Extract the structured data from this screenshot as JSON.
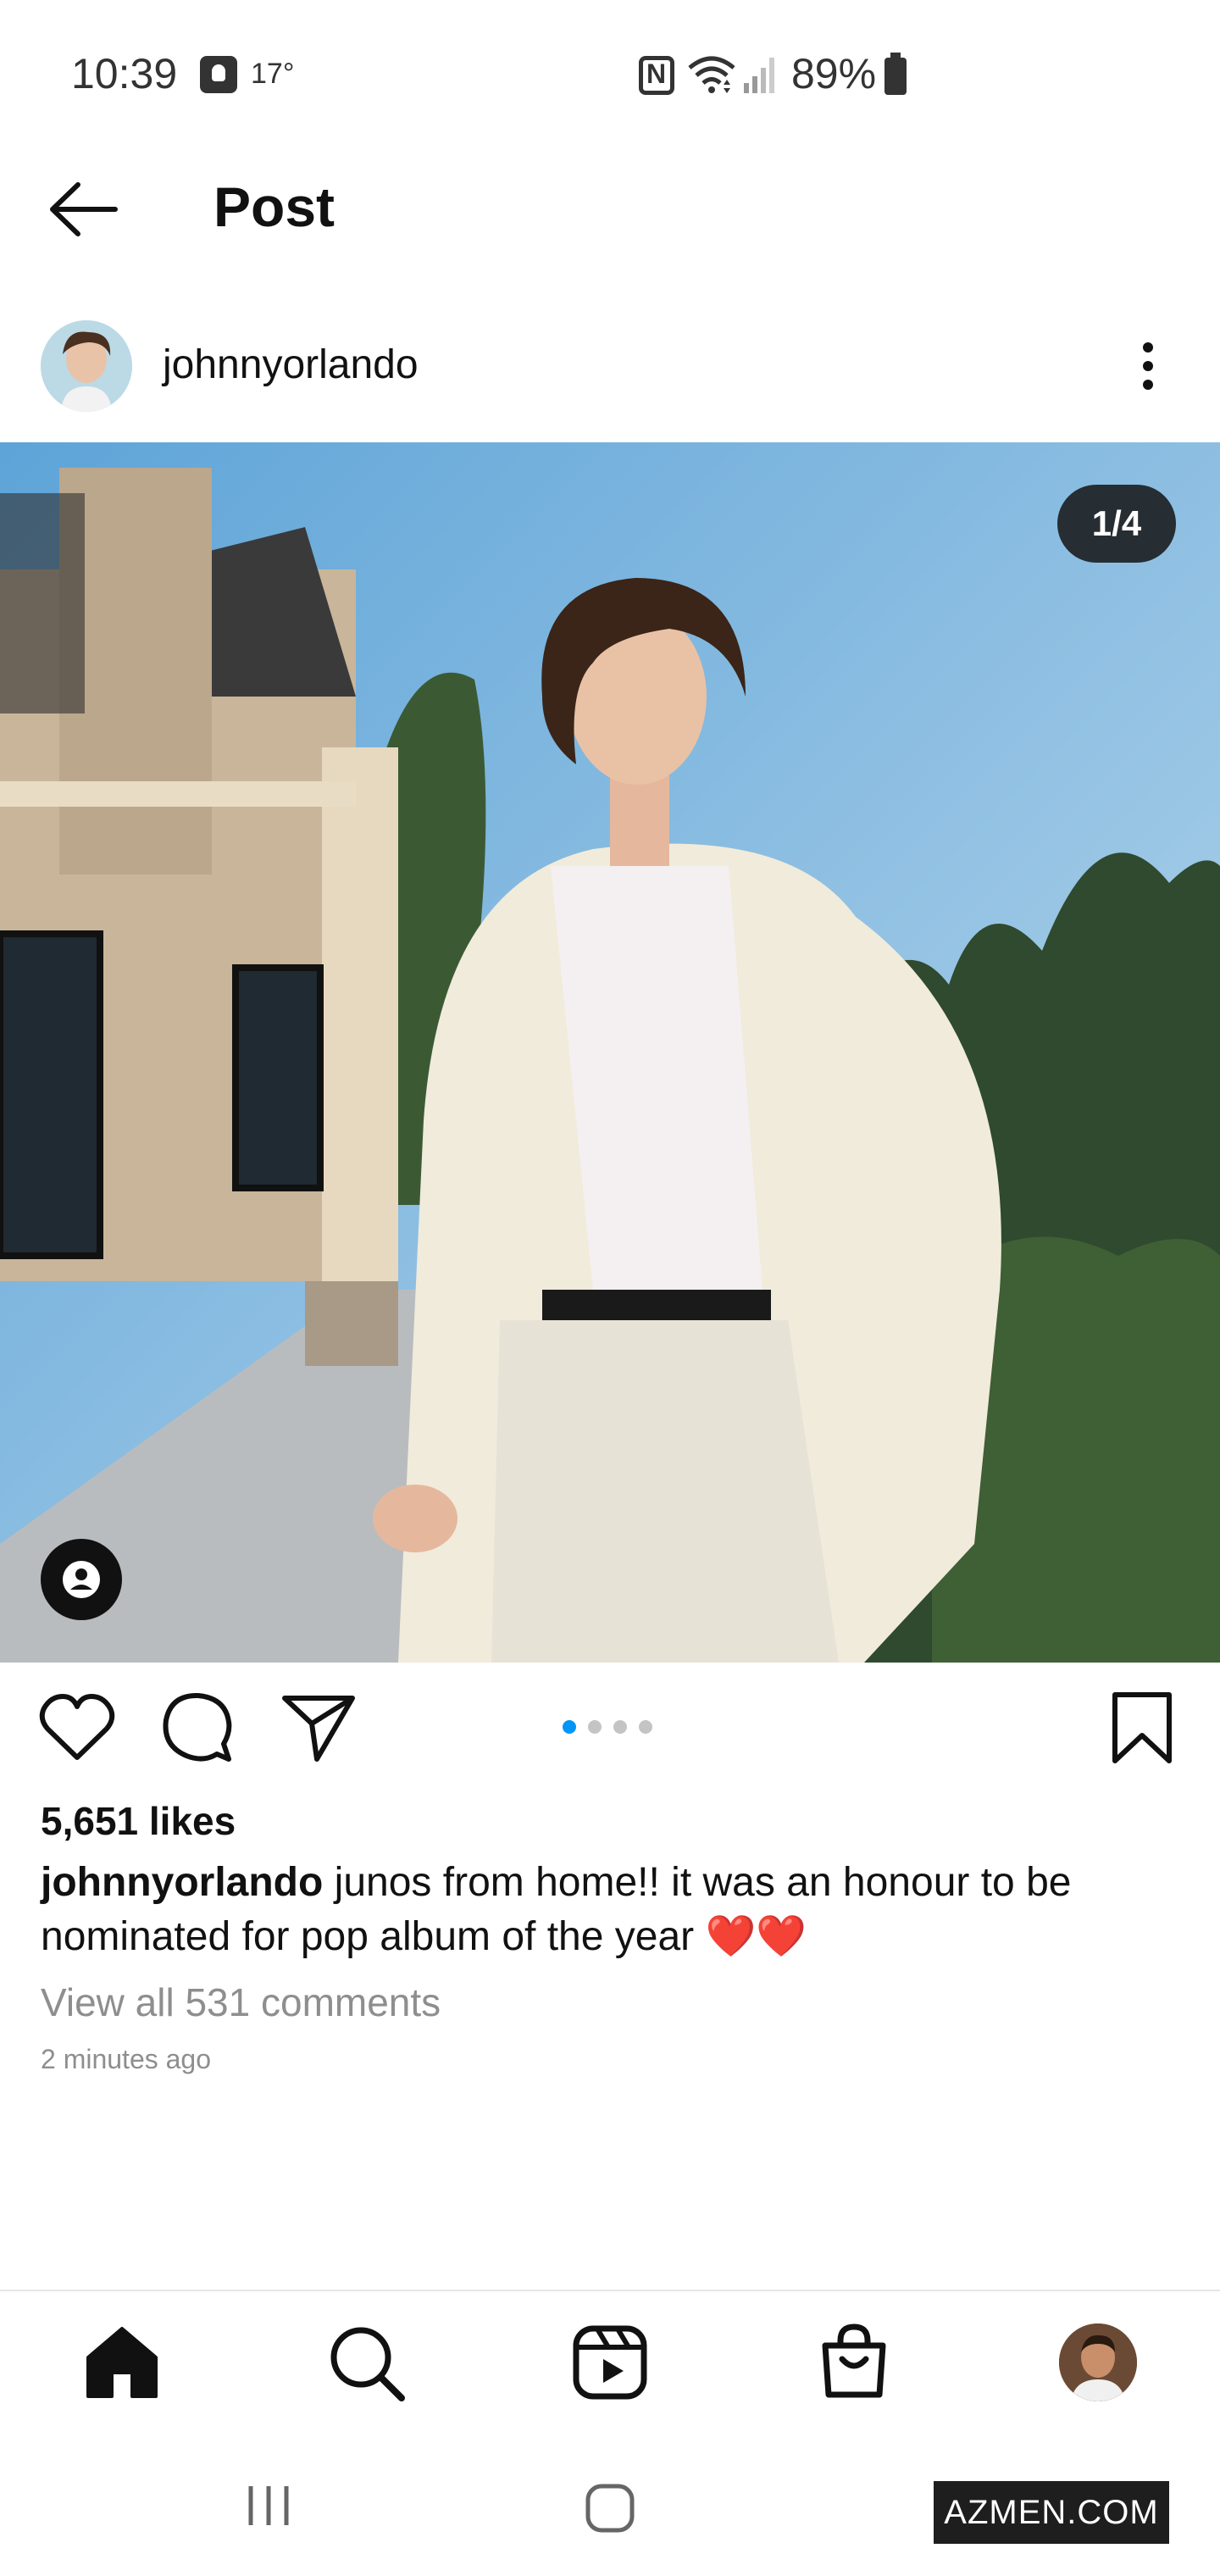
{
  "status_bar": {
    "time": "10:39",
    "temperature": "17°",
    "battery_percent": "89%",
    "icons": [
      "weather-icon",
      "nfc-icon",
      "wifi-icon",
      "signal-icon",
      "battery-icon"
    ]
  },
  "header": {
    "title": "Post",
    "back_icon": "arrow-left-icon"
  },
  "post": {
    "username": "johnnyorlando",
    "image_counter": "1/4",
    "carousel": {
      "total": 4,
      "active_index": 0
    },
    "likes": "5,651 likes",
    "caption_username": "johnnyorlando",
    "caption_text": "junos from home!! it was an honour to be nominated for pop album of the year ❤️❤️",
    "view_comments": "View all 531 comments",
    "timestamp": "2 minutes ago"
  },
  "bottom_nav": {
    "items": [
      "home-icon",
      "search-icon",
      "reels-icon",
      "shop-icon",
      "profile-avatar"
    ]
  },
  "system_nav": {
    "items": [
      "recents-icon",
      "home-button-icon",
      "back-icon"
    ]
  },
  "watermark": "AZMEN.COM",
  "colors": {
    "accent": "#0095f6",
    "muted_text": "#8e8e8e",
    "text": "#111111"
  }
}
